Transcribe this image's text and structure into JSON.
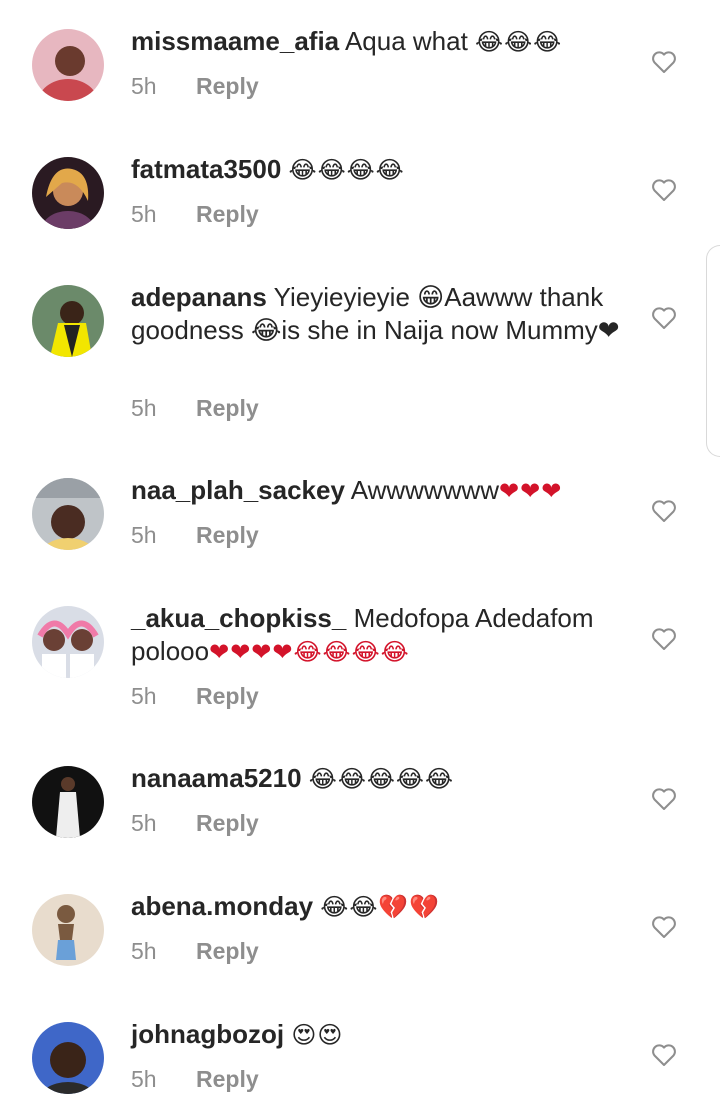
{
  "comments": [
    {
      "user": "missmaame_afia",
      "text": "Aqua what",
      "emoji": "😂😂😂",
      "time": "5h",
      "reply": "Reply",
      "avatar_bg": "#e7b7c0",
      "avatar_fg": "#6a3a2e"
    },
    {
      "user": "fatmata3500",
      "text": "",
      "emoji": "😂😂😂😂",
      "time": "5h",
      "reply": "Reply",
      "avatar_bg": "#2a1a22",
      "avatar_fg": "#c98a5a"
    },
    {
      "user": "adepanans",
      "text": "Yieyieyieyie 😁Aawww thank goodness 😂is she in Naija now Mummy❤",
      "emoji": "",
      "time": "5h",
      "reply": "Reply",
      "avatar_bg": "#6b8a6a",
      "avatar_fg": "#f2e600"
    },
    {
      "user": "naa_plah_sackey",
      "text": "Awwwwwww",
      "emoji": "❤❤❤",
      "time": "5h",
      "reply": "Reply",
      "avatar_bg": "#bfc4c8",
      "avatar_fg": "#4a2c22"
    },
    {
      "user": "_akua_chopkiss_",
      "text": "Medofopa Adedafom polooo",
      "emoji": "❤❤❤❤😂😂😂😂",
      "time": "5h",
      "reply": "Reply",
      "avatar_bg": "#d9dde6",
      "avatar_fg": "#6a4035"
    },
    {
      "user": "nanaama5210",
      "text": "",
      "emoji": "😂😂😂😂😂",
      "time": "5h",
      "reply": "Reply",
      "avatar_bg": "#111111",
      "avatar_fg": "#eeeeee"
    },
    {
      "user": "abena.monday",
      "text": "",
      "emoji": "😂😂💔💔",
      "time": "5h",
      "reply": "Reply",
      "avatar_bg": "#e8dccd",
      "avatar_fg": "#7a5a40"
    },
    {
      "user": "johnagbozoj",
      "text": "",
      "emoji": "😍😍",
      "time": "5h",
      "reply": "Reply",
      "avatar_bg": "#3f67c8",
      "avatar_fg": "#3a2418"
    }
  ]
}
